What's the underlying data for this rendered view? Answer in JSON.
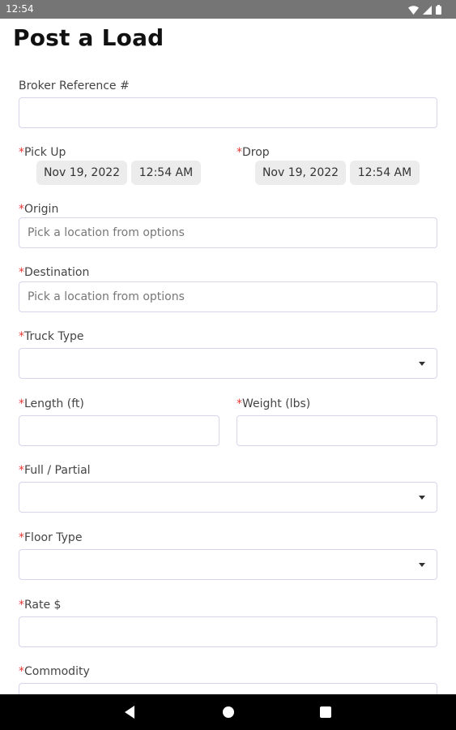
{
  "status_bar": {
    "time": "12:54"
  },
  "page": {
    "title": "Post a Load"
  },
  "required_mark": "*",
  "form": {
    "broker_reference": {
      "label": "Broker Reference #",
      "value": ""
    },
    "pick_up": {
      "label": "Pick Up",
      "date": "Nov 19, 2022",
      "time": "12:54 AM"
    },
    "drop": {
      "label": "Drop",
      "date": "Nov 19, 2022",
      "time": "12:54 AM"
    },
    "origin": {
      "label": "Origin",
      "placeholder": "Pick a location from options",
      "value": ""
    },
    "destination": {
      "label": "Destination",
      "placeholder": "Pick a location from options",
      "value": ""
    },
    "truck_type": {
      "label": "Truck Type",
      "selected": ""
    },
    "length": {
      "label": "Length (ft)",
      "value": ""
    },
    "weight": {
      "label": "Weight (lbs)",
      "value": ""
    },
    "full_partial": {
      "label": "Full / Partial",
      "selected": ""
    },
    "floor_type": {
      "label": "Floor Type",
      "selected": ""
    },
    "rate": {
      "label": "Rate $",
      "value": ""
    },
    "commodity": {
      "label": "Commodity",
      "value": ""
    }
  },
  "icons": {
    "status": [
      "wifi-icon",
      "cell-signal-icon",
      "battery-icon"
    ],
    "nav": [
      "back-icon",
      "home-icon",
      "recents-icon"
    ]
  }
}
